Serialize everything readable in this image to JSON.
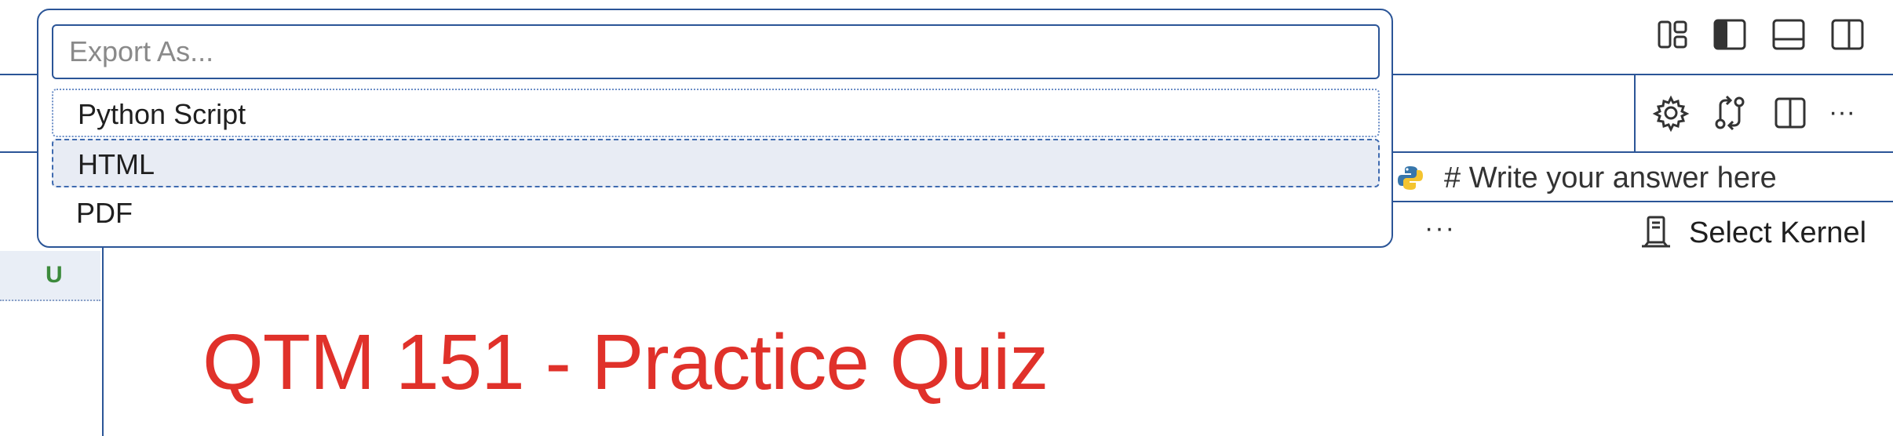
{
  "quick_pick": {
    "placeholder": "Export As...",
    "value": "",
    "items": [
      {
        "label": "Python Script",
        "state": "focused"
      },
      {
        "label": "HTML",
        "state": "selected"
      },
      {
        "label": "PDF",
        "state": "normal"
      }
    ]
  },
  "title_bar": {
    "layout_icons": [
      "customize-layout-icon",
      "toggle-primary-sidebar-icon",
      "toggle-panel-icon",
      "toggle-secondary-sidebar-icon"
    ]
  },
  "editor_toolbar": {
    "icons": [
      "gear-icon",
      "source-control-compare-icon",
      "split-editor-icon",
      "more-actions-icon"
    ],
    "more_glyph": "···"
  },
  "cell": {
    "language_icon": "python-icon",
    "code_line": "# Write your answer here",
    "more_glyph": "···",
    "kernel_icon": "server-kernel-icon",
    "kernel_label": "Select Kernel"
  },
  "gutter": {
    "badge": "U"
  },
  "notebook": {
    "title": "QTM 151 - Practice Quiz"
  },
  "colors": {
    "accent": "#2b5597",
    "title_red": "#e0312a",
    "selected_bg": "#e8ecf4",
    "untracked_green": "#3c8a3c"
  }
}
